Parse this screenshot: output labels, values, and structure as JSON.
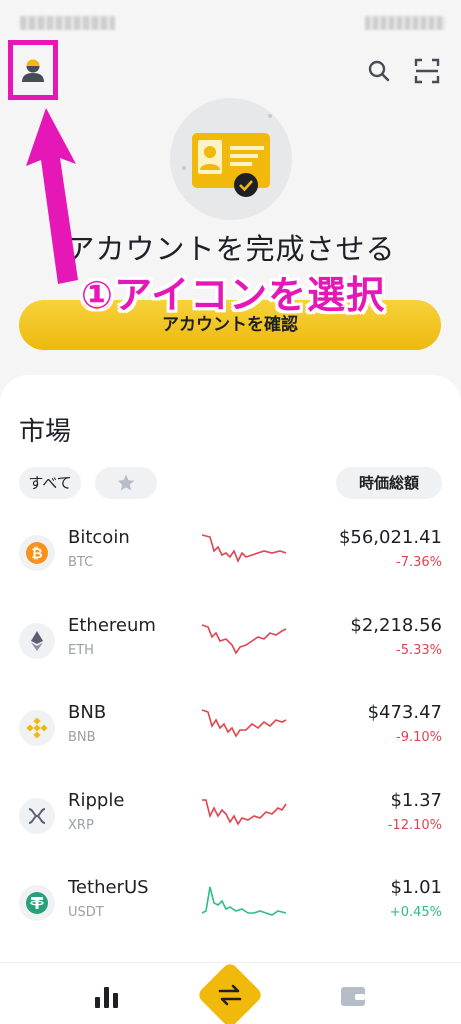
{
  "hero": {
    "title": "アカウントを完成させる",
    "subtitle": "",
    "button_label": "アカウントを確認"
  },
  "annotation": {
    "text": "①アイコンを選択",
    "color": "#e617b7"
  },
  "market": {
    "title": "市場",
    "filter_all": "すべて",
    "filter_cap": "時価総額",
    "coins": [
      {
        "name": "Bitcoin",
        "symbol": "BTC",
        "price": "$56,021.41",
        "change": "-7.36%",
        "trend": "down",
        "icon": "bitcoin-icon"
      },
      {
        "name": "Ethereum",
        "symbol": "ETH",
        "price": "$2,218.56",
        "change": "-5.33%",
        "trend": "down",
        "icon": "ethereum-icon"
      },
      {
        "name": "BNB",
        "symbol": "BNB",
        "price": "$473.47",
        "change": "-9.10%",
        "trend": "down",
        "icon": "bnb-icon"
      },
      {
        "name": "Ripple",
        "symbol": "XRP",
        "price": "$1.37",
        "change": "-12.10%",
        "trend": "down",
        "icon": "ripple-icon"
      },
      {
        "name": "TetherUS",
        "symbol": "USDT",
        "price": "$1.01",
        "change": "+0.45%",
        "trend": "up",
        "icon": "tether-icon"
      }
    ]
  },
  "colors": {
    "accent": "#f0b90b",
    "negative": "#e0444f",
    "positive": "#2ebd85",
    "annotation": "#e617b7"
  }
}
